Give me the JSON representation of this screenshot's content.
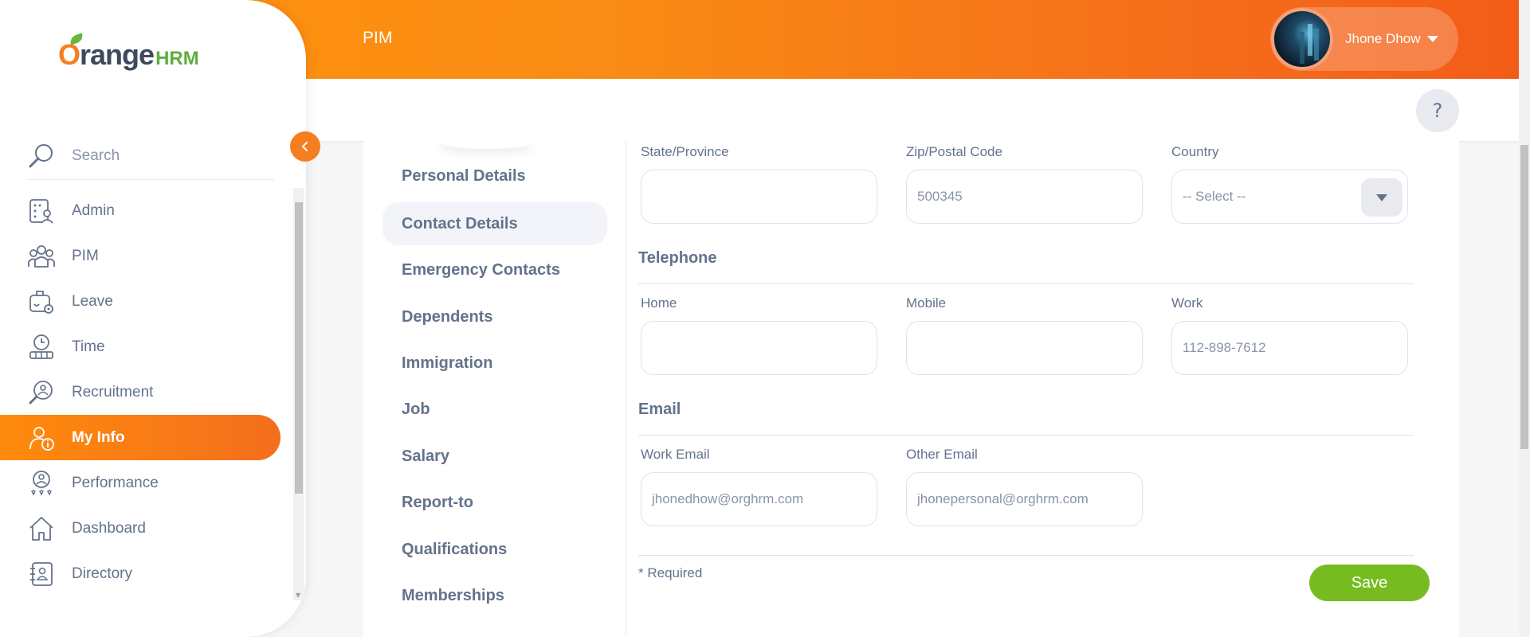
{
  "header": {
    "module_title": "PIM",
    "user_name": "Jhone Dhow",
    "help_label": "?"
  },
  "sidebar": {
    "logo_orange": "range",
    "logo_o": "O",
    "logo_hrm": "HRM",
    "search_label": "Search",
    "items": [
      {
        "label": "Admin",
        "icon": "admin-icon"
      },
      {
        "label": "PIM",
        "icon": "pim-icon"
      },
      {
        "label": "Leave",
        "icon": "leave-icon"
      },
      {
        "label": "Time",
        "icon": "time-icon"
      },
      {
        "label": "Recruitment",
        "icon": "recruitment-icon"
      },
      {
        "label": "My Info",
        "icon": "my-info-icon",
        "active": true
      },
      {
        "label": "Performance",
        "icon": "performance-icon"
      },
      {
        "label": "Dashboard",
        "icon": "dashboard-icon"
      },
      {
        "label": "Directory",
        "icon": "directory-icon"
      }
    ]
  },
  "tabs": [
    {
      "label": "Personal Details"
    },
    {
      "label": "Contact Details",
      "active": true
    },
    {
      "label": "Emergency Contacts"
    },
    {
      "label": "Dependents"
    },
    {
      "label": "Immigration"
    },
    {
      "label": "Job"
    },
    {
      "label": "Salary"
    },
    {
      "label": "Report-to"
    },
    {
      "label": "Qualifications"
    },
    {
      "label": "Memberships"
    }
  ],
  "form": {
    "address": {
      "state_label": "State/Province",
      "state_value": "",
      "zip_label": "Zip/Postal Code",
      "zip_value": "500345",
      "country_label": "Country",
      "country_value": "-- Select --"
    },
    "telephone": {
      "title": "Telephone",
      "home_label": "Home",
      "home_value": "",
      "mobile_label": "Mobile",
      "mobile_value": "",
      "work_label": "Work",
      "work_value": "112-898-7612"
    },
    "email": {
      "title": "Email",
      "work_label": "Work Email",
      "work_value": "jhonedhow@orghrm.com",
      "other_label": "Other Email",
      "other_value": "jhonepersonal@orghrm.com"
    },
    "required_note": "* Required",
    "save_label": "Save"
  },
  "colors": {
    "brand_orange": "#f57e20",
    "save_green": "#76bc21"
  }
}
